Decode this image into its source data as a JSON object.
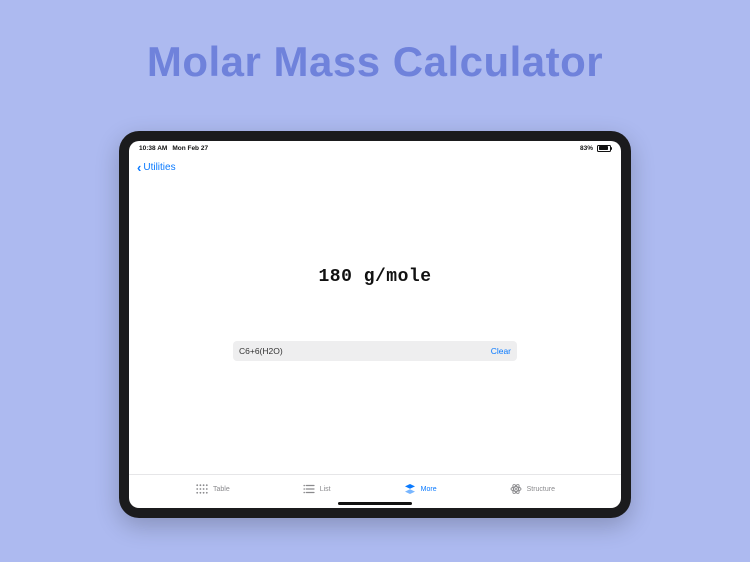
{
  "page": {
    "title": "Molar Mass Calculator"
  },
  "status": {
    "time": "10:38 AM",
    "date": "Mon Feb 27",
    "battery_pct": "83%"
  },
  "nav": {
    "back_label": "Utilities"
  },
  "calc": {
    "result": "180 g/mole",
    "formula_value": "C6+6(H2O)",
    "clear_label": "Clear"
  },
  "tabs": [
    {
      "id": "table",
      "label": "Table",
      "active": false
    },
    {
      "id": "list",
      "label": "List",
      "active": false
    },
    {
      "id": "more",
      "label": "More",
      "active": true
    },
    {
      "id": "structure",
      "label": "Structure",
      "active": false
    }
  ],
  "colors": {
    "accent": "#0a7aff",
    "bg": "#adbaf0",
    "title": "#6f82db"
  }
}
